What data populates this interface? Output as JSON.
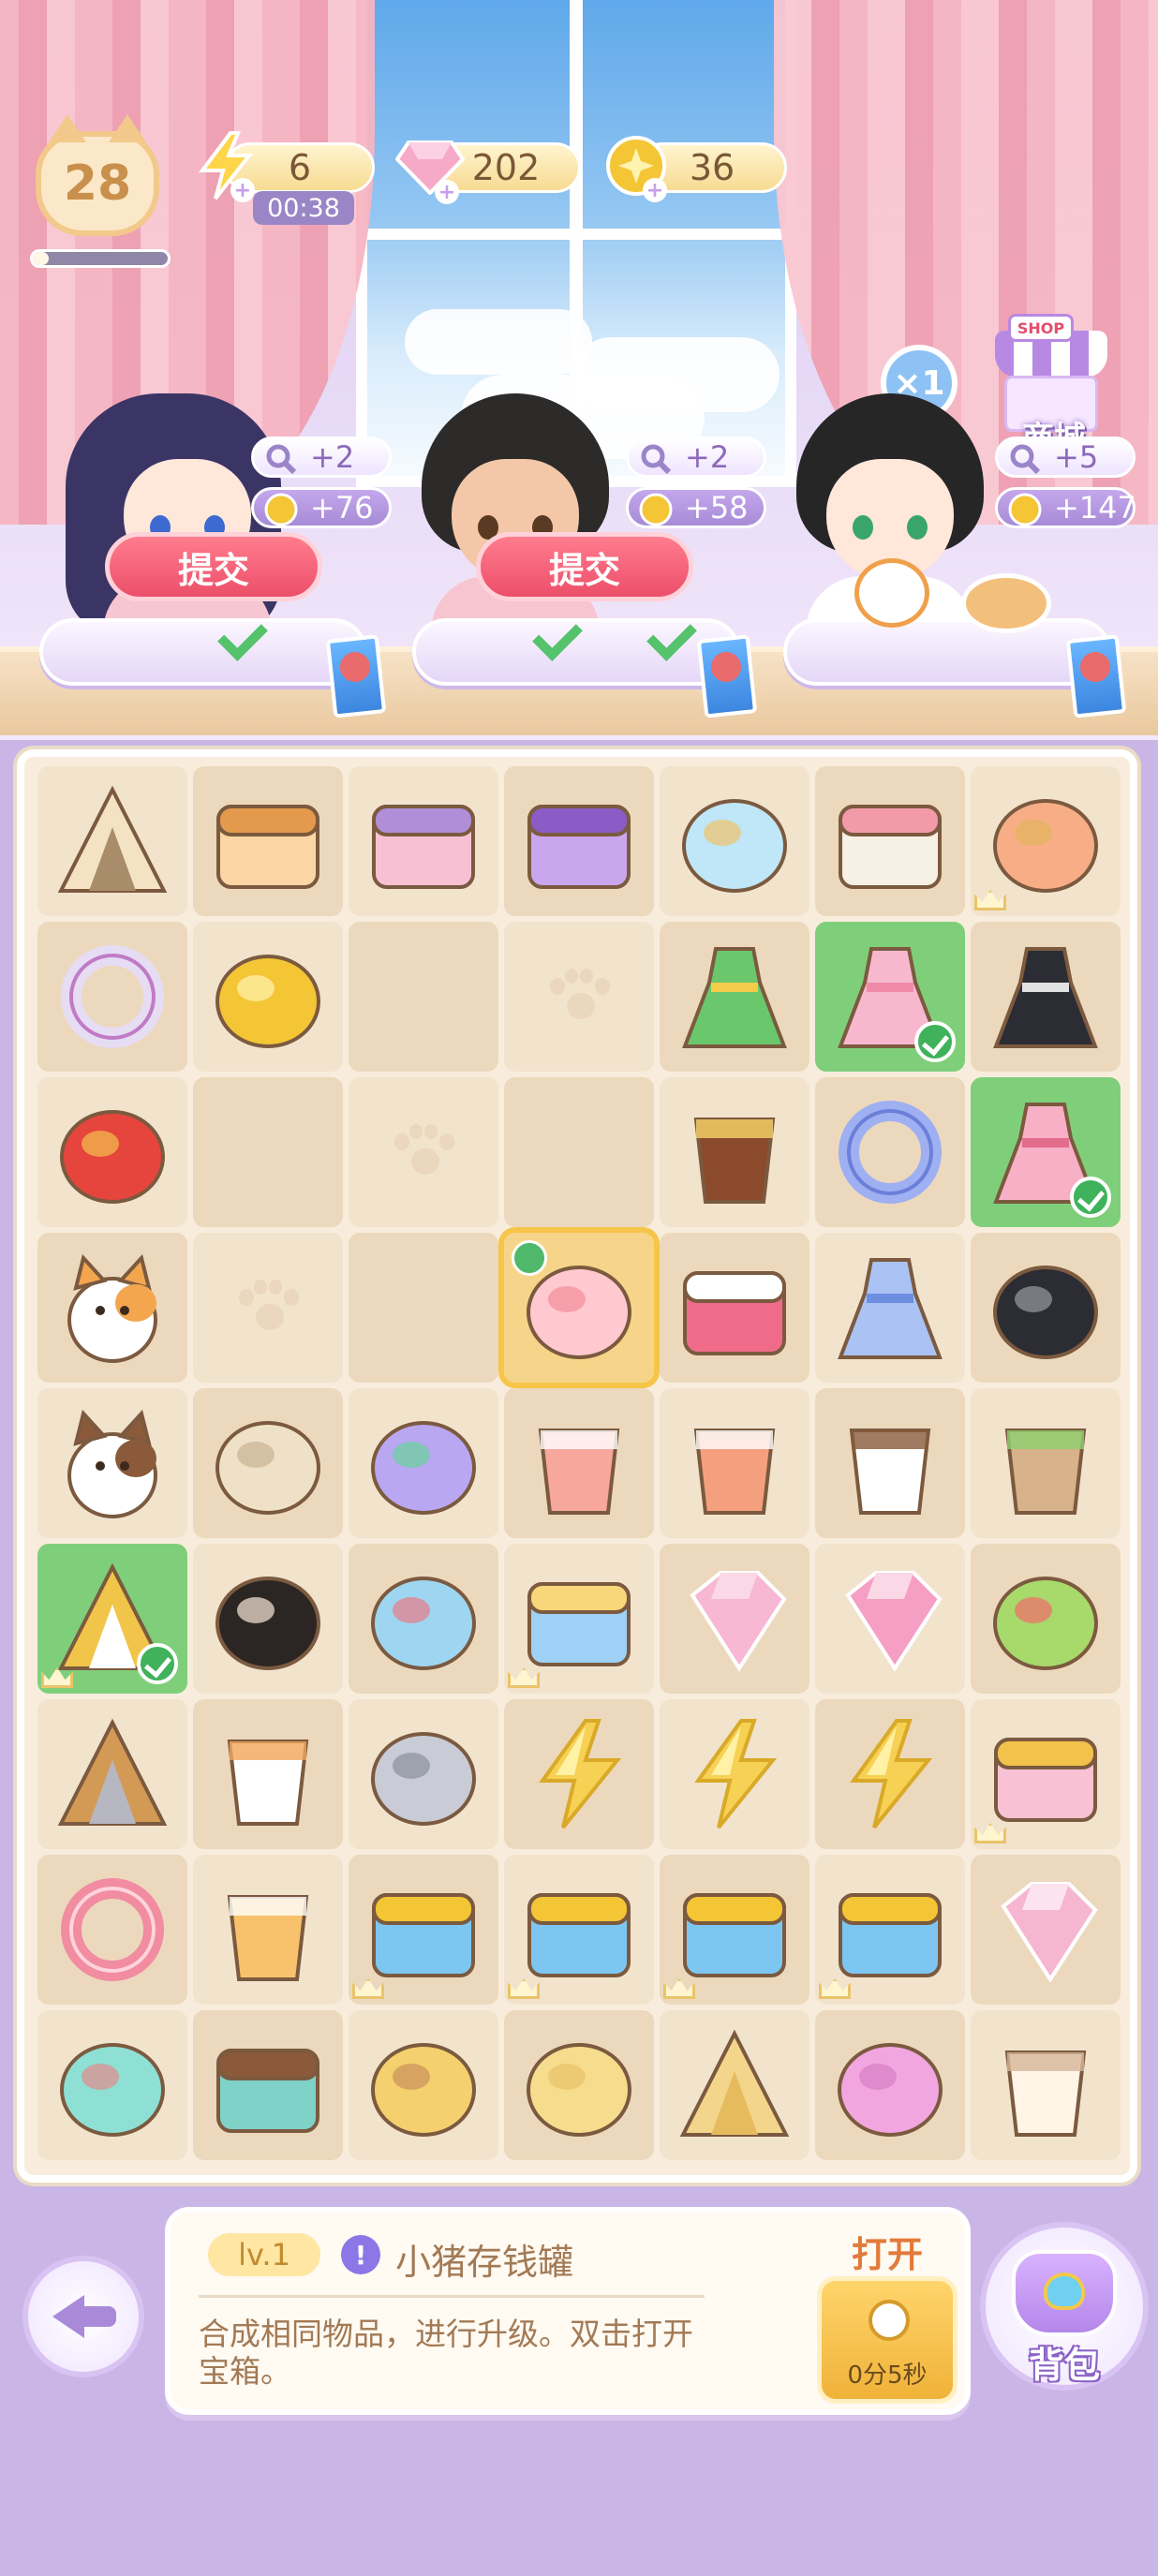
{
  "hud": {
    "player_level": "28",
    "xp_progress": 0.12,
    "energy": {
      "value": "6",
      "timer": "00:38",
      "icon": "lightning-icon"
    },
    "gems": {
      "value": "202",
      "icon": "gem-icon"
    },
    "coins": {
      "value": "36",
      "icon": "coin-icon"
    }
  },
  "shop": {
    "label": "商城",
    "sign": "SHOP"
  },
  "multiplier": "×1",
  "orders": [
    {
      "search_reward": "+2",
      "coin_reward": "+76",
      "submit_label": "提交",
      "items_done": true
    },
    {
      "search_reward": "+2",
      "coin_reward": "+58",
      "submit_label": "提交",
      "items_done": true
    },
    {
      "search_reward": "+5",
      "coin_reward": "+147",
      "submit_label": "",
      "items_done": false
    }
  ],
  "board": {
    "columns": 7,
    "rows": [
      [
        "teepee-tent",
        "dresser",
        "clothes-rack",
        "treasure-chest",
        "fishbowl",
        "flower-shelf",
        "flower-basket"
      ],
      [
        "pearl-hairband",
        "gold-coin",
        "empty",
        "paw-empty",
        "green-dress",
        "pink-dress",
        "black-dress"
      ],
      [
        "fruit-basket",
        "empty",
        "paw-empty",
        "empty",
        "iced-cola",
        "blue-scrunchie",
        "pink-kimono"
      ],
      [
        "calico-cat",
        "paw-empty",
        "empty",
        "piggy-bank",
        "pink-wallet",
        "blue-jacket",
        "black-bow"
      ],
      [
        "brown-cat",
        "blonde-wig",
        "flower-bouquet",
        "strawberry-parfait",
        "iced-tea",
        "coffee-cup",
        "matcha-parfait"
      ],
      [
        "candelabra",
        "black-wig",
        "seashell",
        "gift-box",
        "pink-gems",
        "pink-gems-pile",
        "fruit-cake"
      ],
      [
        "shovel",
        "milk-jug",
        "silver-coins",
        "energy-pile",
        "energy-double",
        "energy-triple",
        "gift-bag"
      ],
      [
        "towel-hook",
        "glass-jar",
        "coin-chest",
        "coin-chest",
        "coin-chest",
        "coin-chest",
        "pink-gem"
      ],
      [
        "pet-bowl",
        "cat-feeder",
        "fish-pan",
        "sand-pile",
        "sand-mound",
        "pink-cushion",
        "milk-pitcher"
      ]
    ],
    "selected_item": "piggy-bank"
  },
  "info": {
    "level": "lv.1",
    "item_name": "小猪存钱罐",
    "description": "合成相同物品，进行升级。双击打开宝箱。",
    "open_label": "打开",
    "open_time": "0分5秒"
  },
  "bag": {
    "label": "背包"
  }
}
